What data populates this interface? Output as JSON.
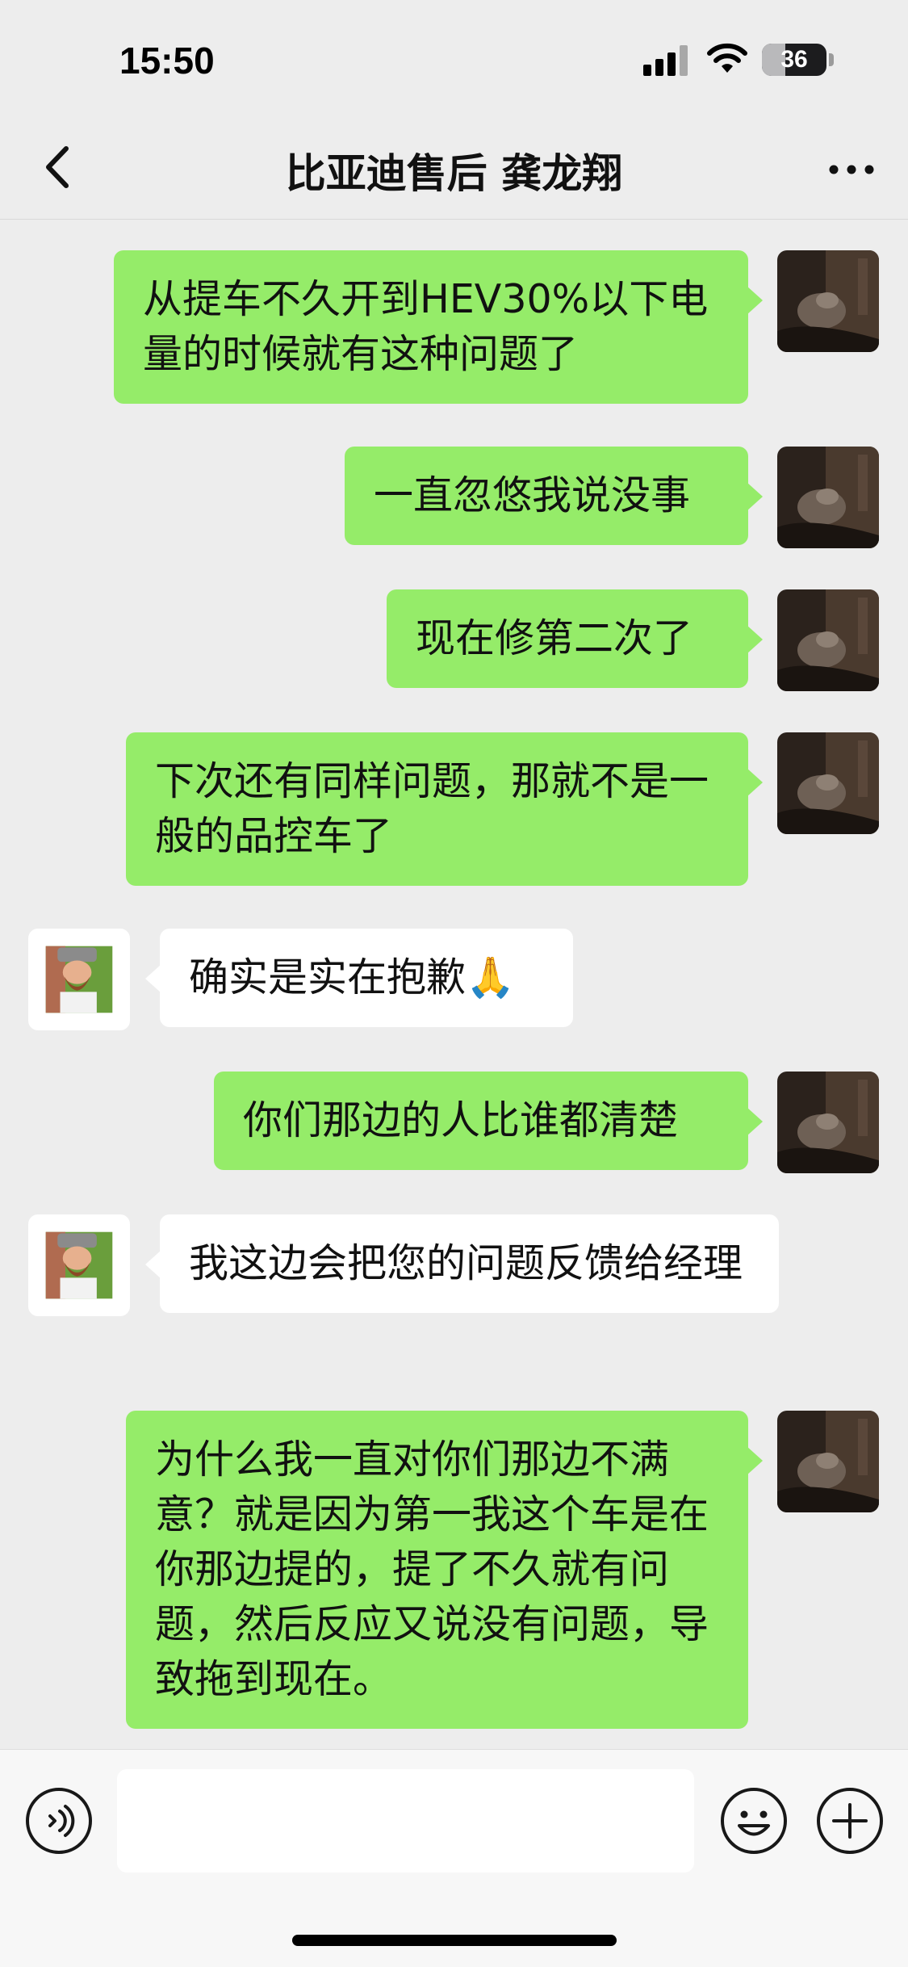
{
  "status_bar": {
    "time": "15:50",
    "battery": "36",
    "battery_level": 0.36
  },
  "nav": {
    "title": "比亚迪售后 龚龙翔"
  },
  "messages": [
    {
      "sender": "me",
      "text": "从提车不久开到HEV30%以下电量的时候就有这种问题了"
    },
    {
      "sender": "me",
      "text": "一直忽悠我说没事"
    },
    {
      "sender": "me",
      "text": "现在修第二次了"
    },
    {
      "sender": "me",
      "text": "下次还有同样问题，那就不是一般的品控车了"
    },
    {
      "sender": "them",
      "text": "确实是实在抱歉🙏"
    },
    {
      "sender": "me",
      "text": "你们那边的人比谁都清楚"
    },
    {
      "sender": "them",
      "text": "我这边会把您的问题反馈给经理"
    },
    {
      "sender": "me",
      "text": "为什么我一直对你们那边不满意？就是因为第一我这个车是在你那边提的，提了不久就有问题，然后反应又说没有问题，导致拖到现在。"
    }
  ],
  "input": {
    "value": ""
  },
  "colors": {
    "my_bubble": "#95ec69",
    "their_bubble": "#ffffff",
    "background": "#ededed"
  }
}
